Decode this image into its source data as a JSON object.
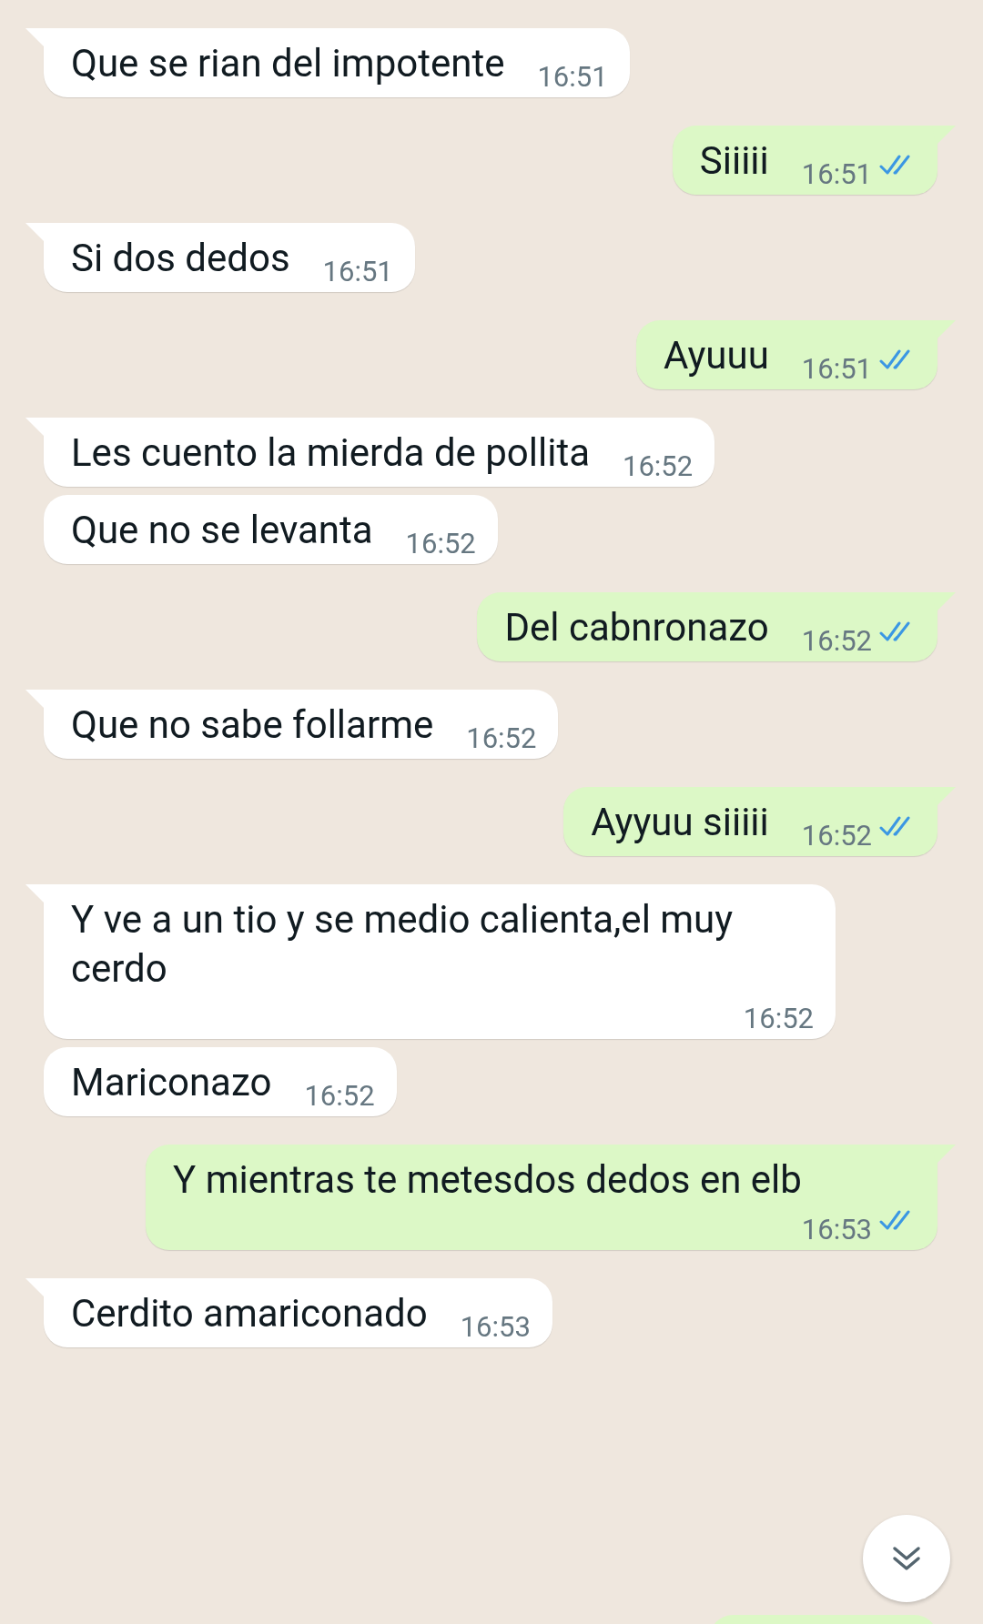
{
  "messages": [
    {
      "kind": "incoming",
      "tail": true,
      "text": "Que se rian del impotente",
      "time": "16:51"
    },
    {
      "kind": "outgoing",
      "tail": true,
      "text": "Siiiii",
      "time": "16:51",
      "read": true
    },
    {
      "kind": "incoming",
      "tail": true,
      "text": "Si dos dedos",
      "time": "16:51"
    },
    {
      "kind": "outgoing",
      "tail": true,
      "text": "Ayuuu",
      "time": "16:51",
      "read": true
    },
    {
      "kind": "incoming",
      "tail": true,
      "text": "Les cuento la mierda de pollita",
      "time": "16:52"
    },
    {
      "kind": "incoming",
      "tail": false,
      "text": "Que no se levanta",
      "time": "16:52"
    },
    {
      "kind": "outgoing",
      "tail": true,
      "text": "Del cabnronazo",
      "time": "16:52",
      "read": true
    },
    {
      "kind": "incoming",
      "tail": true,
      "text": "Que no sabe follarme",
      "time": "16:52"
    },
    {
      "kind": "outgoing",
      "tail": true,
      "text": "Ayyuu siiiii",
      "time": "16:52",
      "read": true
    },
    {
      "kind": "incoming",
      "tail": true,
      "text": "Y ve a un tio y se medio calienta,el muy cerdo",
      "time": "16:52"
    },
    {
      "kind": "incoming",
      "tail": false,
      "text": "Mariconazo",
      "time": "16:52"
    },
    {
      "kind": "outgoing",
      "tail": true,
      "text": "Y mientras te metesdos dedos en elb",
      "time": "16:53",
      "read": true
    },
    {
      "kind": "incoming",
      "tail": true,
      "text": "Cerdito amariconado",
      "time": "16:53"
    }
  ]
}
